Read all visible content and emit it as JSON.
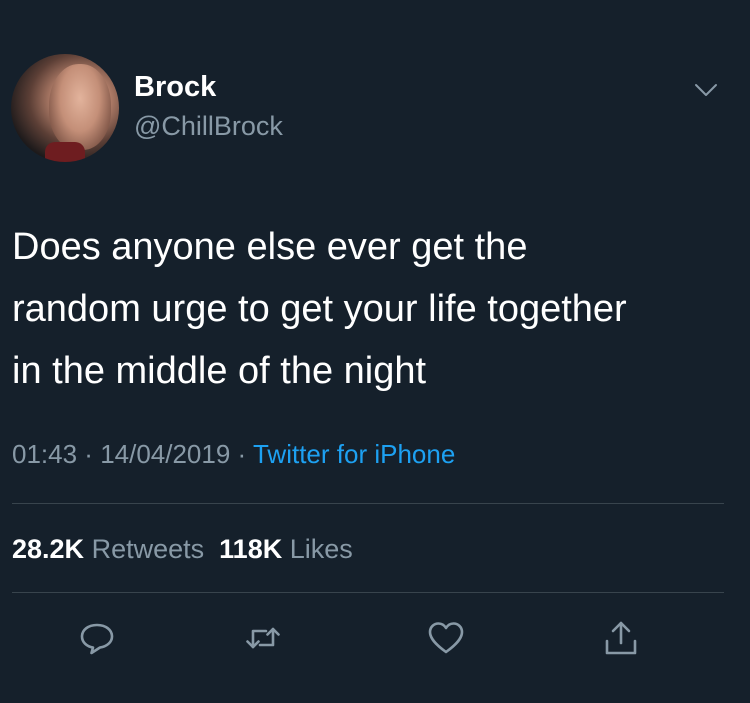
{
  "user": {
    "display_name": "Brock",
    "handle": "@ChillBrock"
  },
  "tweet": {
    "text_lines": [
      "Does anyone else ever get the",
      "random urge to get your life together",
      "in the middle of the night"
    ],
    "time": "01:43",
    "date": "14/04/2019",
    "separator": " · ",
    "source": "Twitter for iPhone"
  },
  "stats": {
    "retweets_count": "28.2K",
    "retweets_label": "Retweets",
    "likes_count": "118K",
    "likes_label": "Likes"
  },
  "actions": {
    "icons": [
      "reply-icon",
      "retweet-icon",
      "like-icon",
      "share-icon"
    ]
  },
  "colors": {
    "background": "#15202b",
    "text_primary": "#ffffff",
    "text_secondary": "#8899a6",
    "link": "#1da1f2",
    "divider": "#38444d"
  }
}
